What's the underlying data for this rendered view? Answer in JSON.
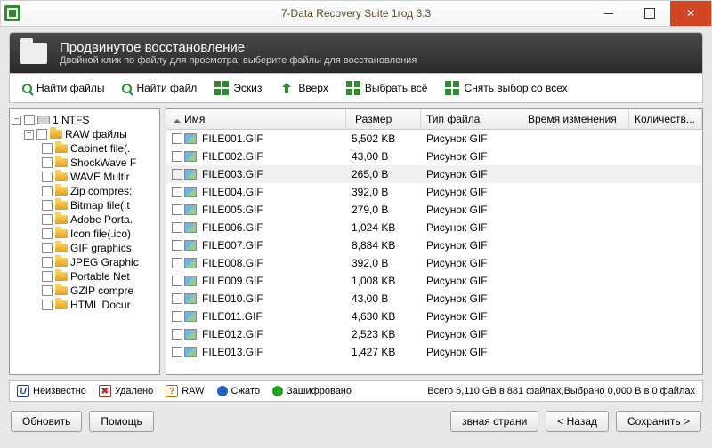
{
  "window": {
    "title": "7-Data Recovery Suite 1год 3.3"
  },
  "header": {
    "title": "Продвинутое восстановление",
    "subtitle": "Двойной клик по файлу для просмотра; выберите файлы для восстановления"
  },
  "toolbar": {
    "find_files": "Найти файлы",
    "find_file": "Найти файл",
    "thumb": "Эскиз",
    "up": "Вверх",
    "select_all": "Выбрать всё",
    "deselect_all": "Снять выбор со всех"
  },
  "tree": {
    "root": "1 NTFS",
    "group": "RAW файлы",
    "items": [
      "Cabinet file(.",
      "ShockWave F",
      "WAVE Multir",
      "Zip compres:",
      "Bitmap file(.t",
      "Adobe Porta.",
      "Icon file(.ico)",
      "GIF graphics",
      "JPEG Graphic",
      "Portable Net",
      "GZIP compre",
      "HTML Docur"
    ]
  },
  "columns": {
    "name": "Имя",
    "size": "Размер",
    "type": "Тип файла",
    "time": "Время изменения",
    "count": "Количеств..."
  },
  "files": [
    {
      "name": "FILE001.GIF",
      "size": "5,502 KB",
      "type": "Рисунок GIF",
      "sel": false
    },
    {
      "name": "FILE002.GIF",
      "size": "43,00 B",
      "type": "Рисунок GIF",
      "sel": false
    },
    {
      "name": "FILE003.GIF",
      "size": "265,0 B",
      "type": "Рисунок GIF",
      "sel": true
    },
    {
      "name": "FILE004.GIF",
      "size": "392,0 B",
      "type": "Рисунок GIF",
      "sel": false
    },
    {
      "name": "FILE005.GIF",
      "size": "279,0 B",
      "type": "Рисунок GIF",
      "sel": false
    },
    {
      "name": "FILE006.GIF",
      "size": "1,024 KB",
      "type": "Рисунок GIF",
      "sel": false
    },
    {
      "name": "FILE007.GIF",
      "size": "8,884 KB",
      "type": "Рисунок GIF",
      "sel": false
    },
    {
      "name": "FILE008.GIF",
      "size": "392,0 B",
      "type": "Рисунок GIF",
      "sel": false
    },
    {
      "name": "FILE009.GIF",
      "size": "1,008 KB",
      "type": "Рисунок GIF",
      "sel": false
    },
    {
      "name": "FILE010.GIF",
      "size": "43,00 B",
      "type": "Рисунок GIF",
      "sel": false
    },
    {
      "name": "FILE011.GIF",
      "size": "4,630 KB",
      "type": "Рисунок GIF",
      "sel": false
    },
    {
      "name": "FILE012.GIF",
      "size": "2,523 KB",
      "type": "Рисунок GIF",
      "sel": false
    },
    {
      "name": "FILE013.GIF",
      "size": "1,427 KB",
      "type": "Рисунок GIF",
      "sel": false
    }
  ],
  "legend": {
    "unknown": "Неизвестно",
    "deleted": "Удалено",
    "raw": "RAW",
    "compressed": "Сжато",
    "encrypted": "Зашифровано",
    "summary": "Всего 6,110 GB в 881 файлах,Выбрано 0,000 B в 0 файлах"
  },
  "buttons": {
    "refresh": "Обновить",
    "help": "Помощь",
    "main_page": "звная страни",
    "back": "< Назад",
    "save": "Сохранить >"
  }
}
